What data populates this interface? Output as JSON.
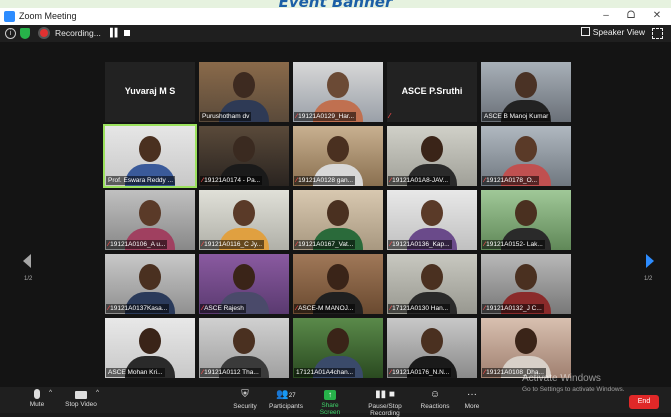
{
  "banner": {
    "text": "Event Banner"
  },
  "window": {
    "title": "Zoom Meeting",
    "min": "–",
    "restore": "ᗝ",
    "close": "✕"
  },
  "topbar": {
    "recording_label": "Recording...",
    "speaker_view": "Speaker View"
  },
  "tiles": [
    [
      {
        "label": "Yuvaraj M S",
        "style": "name-only",
        "muted": false
      },
      {
        "label": "Purushotham dv",
        "muted": false
      },
      {
        "label": "19121A0129_Har...",
        "muted": true
      },
      {
        "label": "ASCE P.Sruthi",
        "style": "name-only",
        "muted": true
      },
      {
        "label": "ASCE B Manoj Kumar",
        "muted": false
      }
    ],
    [
      {
        "label": "Prof. Eswara Reddy ...",
        "muted": false,
        "active": true
      },
      {
        "label": "19121A0174 - Pa...",
        "muted": true
      },
      {
        "label": "19121A0128 gan...",
        "muted": true
      },
      {
        "label": "19121A01A8-JAV...",
        "muted": true
      },
      {
        "label": "19121A0178_O...",
        "muted": true
      }
    ],
    [
      {
        "label": "19121A0106_A u...",
        "muted": true
      },
      {
        "label": "19121A0116_C Jy...",
        "muted": true
      },
      {
        "label": "19121A0167_Vat...",
        "muted": true
      },
      {
        "label": "19121A0136_Kap...",
        "muted": true
      },
      {
        "label": "19121A0152- Lak...",
        "muted": true
      }
    ],
    [
      {
        "label": "19121A0137Kasa...",
        "muted": true
      },
      {
        "label": "ASCE Rajesh",
        "muted": true
      },
      {
        "label": "ASCE-M MANOJ...",
        "muted": true
      },
      {
        "label": "17121A0130 Han...",
        "muted": true
      },
      {
        "label": "19121A0132_J C...",
        "muted": true
      }
    ],
    [
      {
        "label": "ASCE Mohan Kri...",
        "muted": false
      },
      {
        "label": "19121A0112 Tha...",
        "muted": true
      },
      {
        "label": "17121A01A4chan...",
        "muted": false
      },
      {
        "label": "19121A0176_N.N...",
        "muted": true
      },
      {
        "label": "19121A0108_Dha...",
        "muted": true
      }
    ]
  ],
  "pagination": {
    "left": "1/2",
    "right": "1/2"
  },
  "toolbar": {
    "mute": "Mute",
    "stop_video": "Stop Video",
    "security": "Security",
    "participants": "Participants",
    "participants_count": "27",
    "share_screen": "Share Screen",
    "pause_recording": "Pause/Stop Recording",
    "reactions": "Reactions",
    "more": "More",
    "end": "End",
    "more_glyph": "···"
  },
  "watermark": {
    "line1": "Activate Windows",
    "line2": "Go to Settings to activate Windows."
  },
  "colors": {
    "accent": "#2d8cff",
    "recording": "#e03131",
    "share": "#27b24a",
    "end": "#e02828",
    "active_border": "#9be15d"
  }
}
